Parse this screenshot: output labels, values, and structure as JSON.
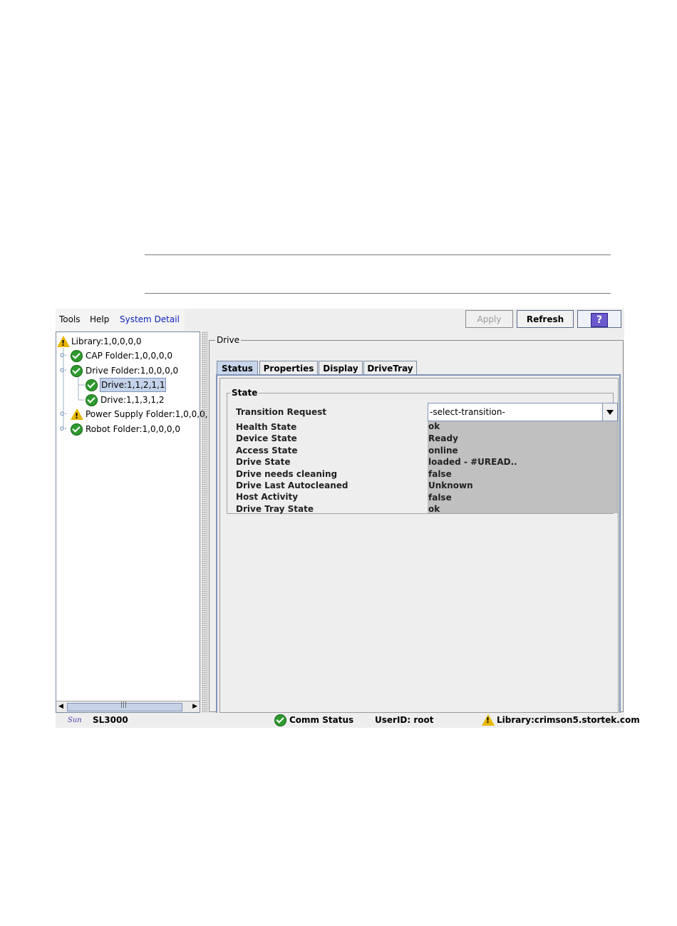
{
  "menu": {
    "tools": "Tools",
    "help": "Help",
    "system_detail": "System Detail"
  },
  "toolbar": {
    "apply": "Apply",
    "refresh": "Refresh",
    "help_icon": "?"
  },
  "tree": {
    "root": "Library:1,0,0,0,0",
    "cap": "CAP Folder:1,0,0,0,0",
    "drive_folder": "Drive Folder:1,0,0,0,0",
    "drive1": "Drive:1,1,2,1,1",
    "drive2": "Drive:1,1,3,1,2",
    "power": "Power Supply Folder:1,0,0,0,",
    "robot": "Robot Folder:1,0,0,0,0",
    "scroll_grip": "|||"
  },
  "panel": {
    "title": "Drive",
    "tabs": [
      "Status",
      "Properties",
      "Display",
      "DriveTray"
    ],
    "state_title": "State"
  },
  "state": {
    "transition_label": "Transition Request",
    "transition_value": "-select-transition-",
    "rows": [
      {
        "label": "Health State",
        "value": "ok"
      },
      {
        "label": "Device State",
        "value": "Ready"
      },
      {
        "label": "Access State",
        "value": "online"
      },
      {
        "label": "Drive State",
        "value": "loaded - #UREAD.."
      },
      {
        "label": "Drive needs cleaning",
        "value": "false"
      },
      {
        "label": "Drive Last Autocleaned",
        "value": "Unknown"
      },
      {
        "label": "Host Activity",
        "value": "false"
      },
      {
        "label": "Drive Tray State",
        "value": "ok"
      }
    ]
  },
  "statusbar": {
    "logo": "Sun",
    "model": "SL3000",
    "comm": "Comm Status",
    "user": "UserID: root",
    "library": "Library:crimson5.stortek.com"
  },
  "colors": {
    "accent": "#0b22b8",
    "ok": "#2e9a2e",
    "warning": "#e6b800",
    "selection": "#c8d6ec"
  },
  "icons": {
    "ok": "check-circle-icon",
    "warning": "warning-triangle-icon",
    "help": "help-icon"
  }
}
